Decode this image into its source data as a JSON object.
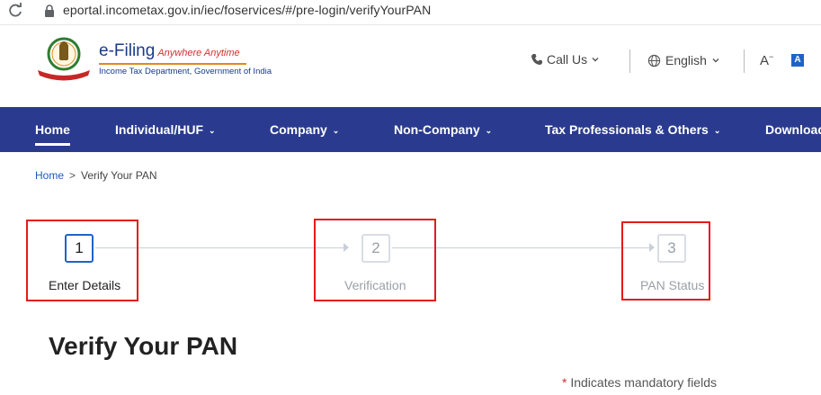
{
  "browser": {
    "url": "eportal.incometax.gov.in/iec/foservices/#/pre-login/verifyYourPAN"
  },
  "header": {
    "brand_main": "e-Filing",
    "brand_tagline": "Anywhere Anytime",
    "brand_sub": "Income Tax Department, Government of India",
    "call_us": "Call Us",
    "language": "English",
    "font_size_toggle": "A",
    "contrast_toggle": "A"
  },
  "nav": {
    "items": [
      {
        "label": "Home",
        "active": true
      },
      {
        "label": "Individual/HUF"
      },
      {
        "label": "Company"
      },
      {
        "label": "Non-Company"
      },
      {
        "label": "Tax Professionals & Others"
      },
      {
        "label": "Downloads"
      }
    ]
  },
  "breadcrumb": {
    "home": "Home",
    "separator": ">",
    "current": "Verify Your PAN"
  },
  "stepper": {
    "steps": [
      {
        "number": "1",
        "label": "Enter Details",
        "active": true
      },
      {
        "number": "2",
        "label": "Verification"
      },
      {
        "number": "3",
        "label": "PAN Status"
      }
    ]
  },
  "main": {
    "title": "Verify Your PAN",
    "mandatory_star": "*",
    "mandatory_note": "Indicates mandatory fields"
  },
  "colors": {
    "nav_bg": "#2a3b8f",
    "accent": "#1e64c8",
    "highlight": "#e41b1b"
  }
}
